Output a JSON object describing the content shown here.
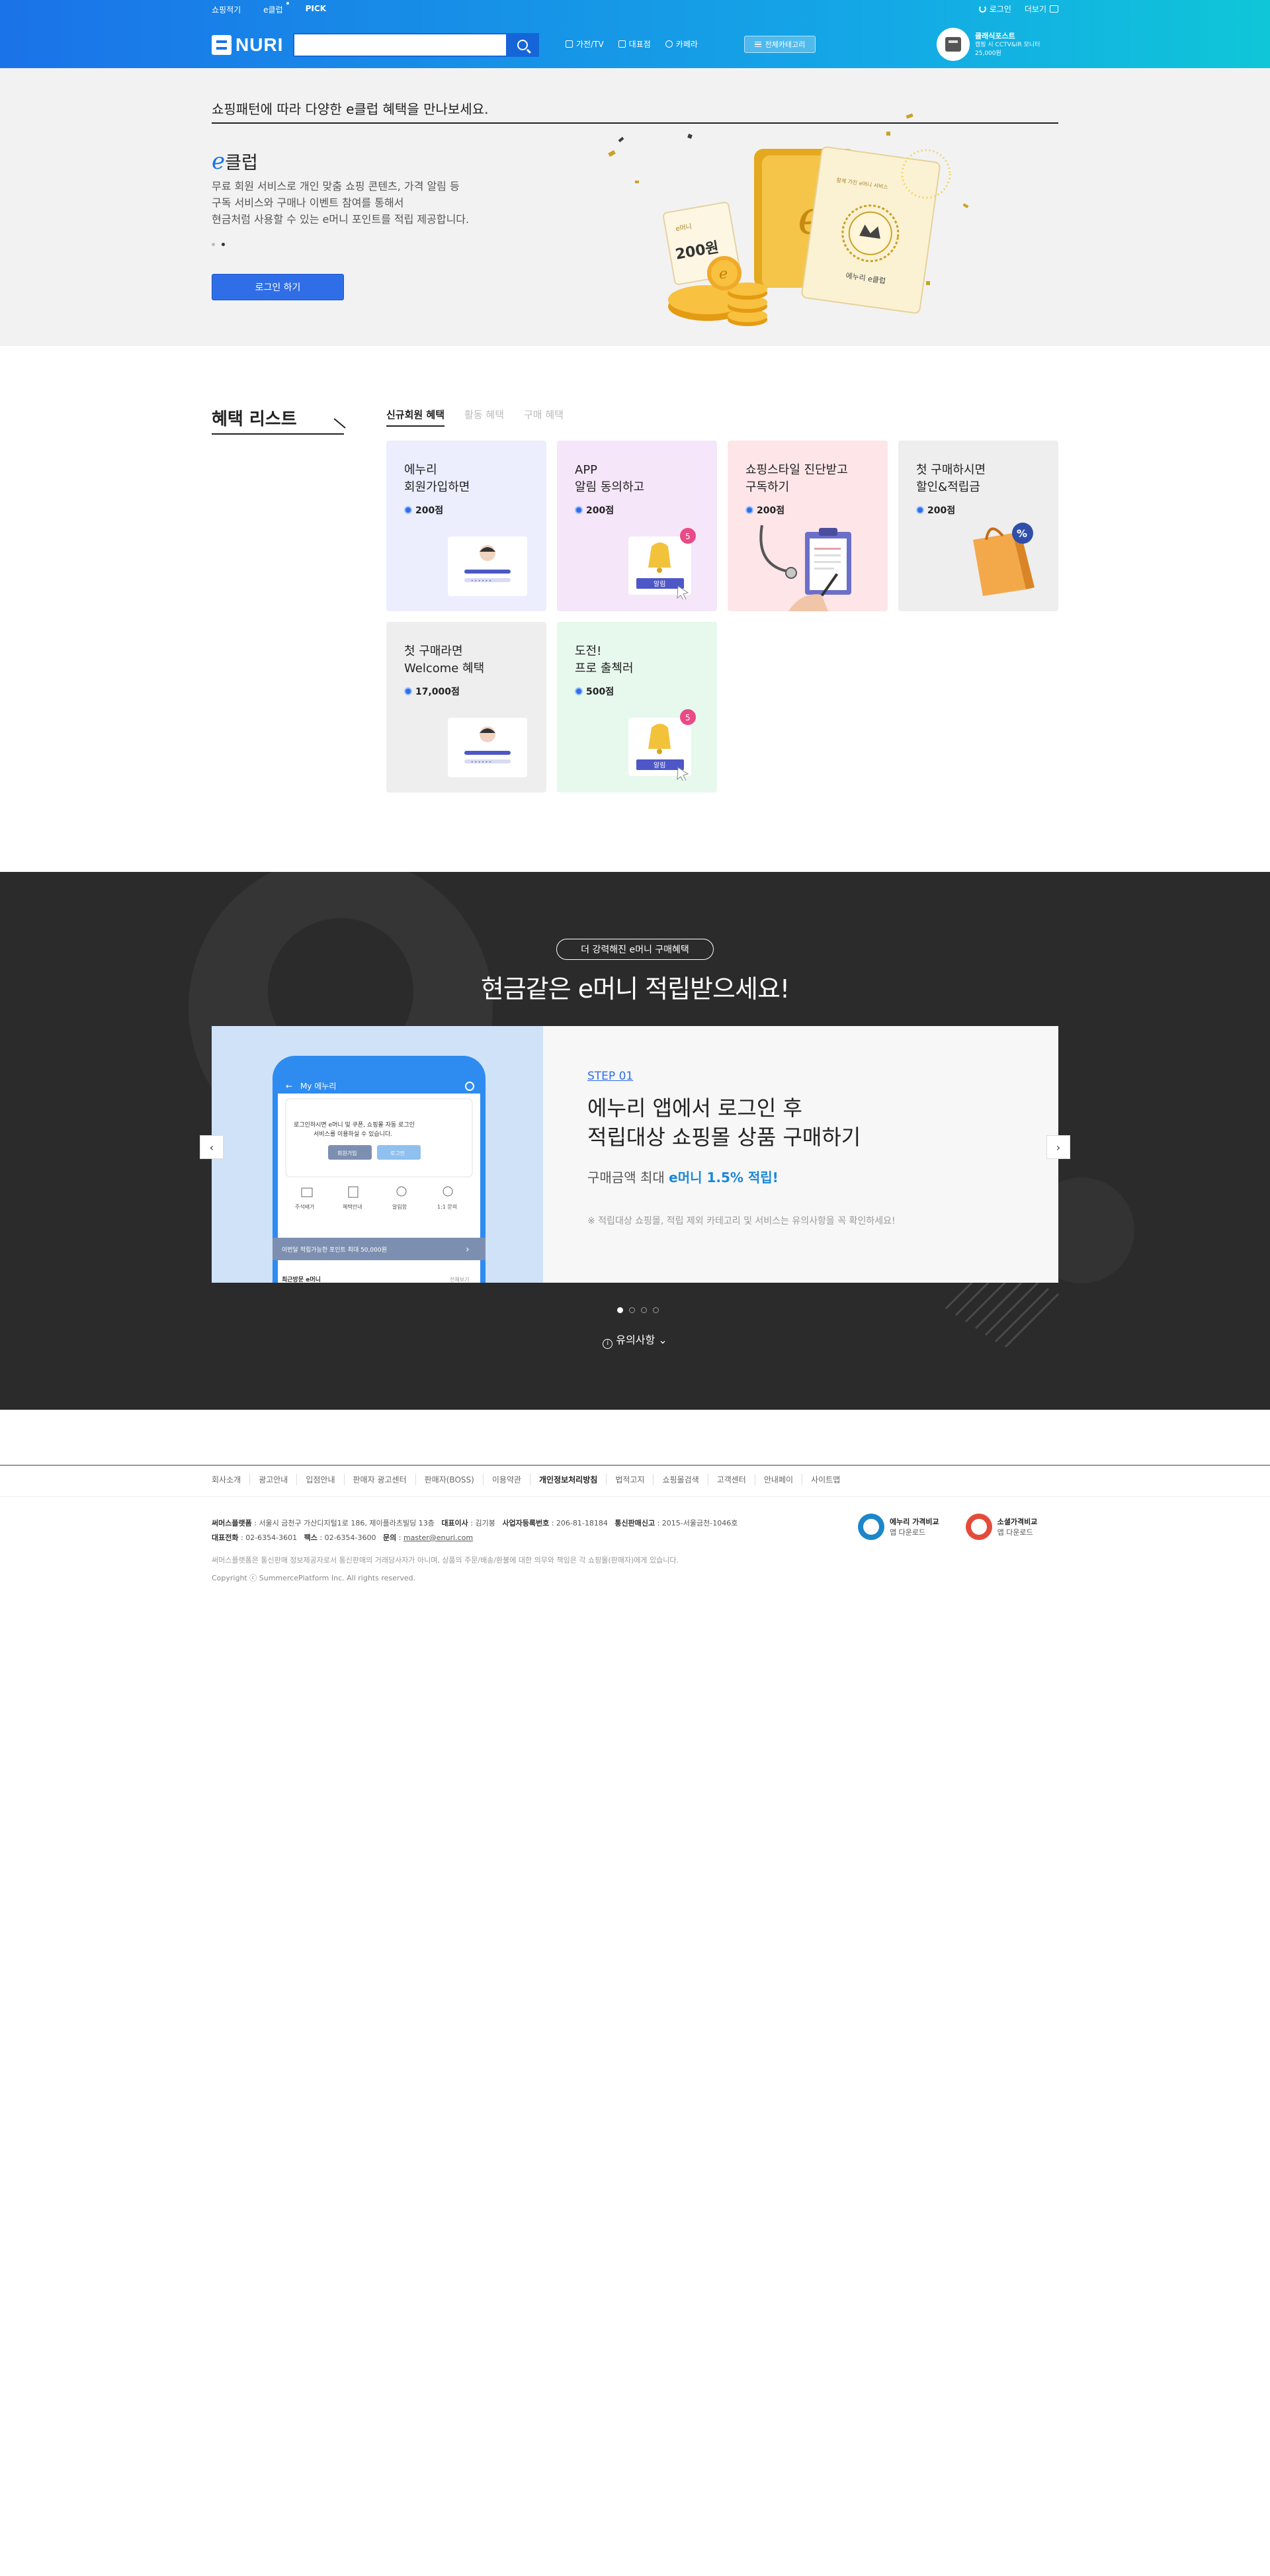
{
  "header": {
    "utility_left": [
      "쇼핑적기",
      "e클럽",
      "PICK"
    ],
    "utility_right": {
      "login": "로그인",
      "more": "더보기"
    },
    "logo_text": "NURI",
    "search_placeholder": "",
    "categories": [
      "가전/TV",
      "대표점",
      "카페라"
    ],
    "mall_button": "전체카테고리",
    "promo": {
      "title": "클래식포스트",
      "line1": "캠핑 시 CCTV&IR 모니터",
      "line2": "25,000원"
    }
  },
  "hero": {
    "heading": "쇼핑패턴에 따라 다양한 e클럽 혜택을 만나보세요.",
    "title_e": "e",
    "title_rest": "클럽",
    "desc": [
      "무료 회원 서비스로 개인 맞춤 쇼핑 콘텐츠, 가격 알림 등",
      "구독 서비스와 구매나 이벤트 참여를 통해서",
      "현금처럼 사용할 수 있는 e머니 포인트를 적립 제공합니다."
    ],
    "login_button": "로그인 하기",
    "illustration_text": {
      "card_top": "함께 가진 e머니 서비스",
      "card_bottom": "에누리 e클럽",
      "ticket_small": "e머니",
      "ticket_value": "200원"
    }
  },
  "benefits": {
    "title": "혜택 리스트",
    "tabs": [
      "신규회원 혜택",
      "활동 혜택",
      "구매 혜택"
    ],
    "cards": [
      {
        "title": "에누리\n회원가입하면",
        "points": "200점"
      },
      {
        "title": "APP\n알림 동의하고",
        "points": "200점",
        "badge": "5",
        "label": "알림"
      },
      {
        "title": "쇼핑스타일 진단받고\n구독하기",
        "points": "200점"
      },
      {
        "title": "첫 구매하시면\n할인&적립금",
        "points": "200점"
      },
      {
        "title": "첫 구매라면\nWelcome 혜택",
        "points": "17,000점"
      },
      {
        "title": "도전!\n프로 출첵러",
        "points": "500점",
        "badge": "5",
        "label": "알림"
      }
    ]
  },
  "promo_section": {
    "badge": "더 강력해진 e머니 구매혜택",
    "title": "현금같은 e머니 적립받으세요!",
    "phone": {
      "title": "My 에누리",
      "msg1": "로그인하시면 e머니 및 쿠폰, 쇼핑몰 자동 로그인",
      "msg2": "서비스를 이용하실 수 있습니다.",
      "btn1": "회원가입",
      "btn2": "로그인",
      "menu": [
        "주석배가",
        "혜택안내",
        "알림함",
        "1:1 문의"
      ],
      "bar": "이번달 적립가능한 포인트 최대 50,000원",
      "footer_left": "최근방문 e머니",
      "footer_right": "전체보기"
    },
    "step": "STEP 01",
    "heading": [
      "에누리 앱에서 로그인 후",
      "적립대상 쇼핑몰 상품 구매하기"
    ],
    "sub_prefix": "구매금액 최대 ",
    "sub_strong": "e머니 1.5% 적립!",
    "note": "※ 적립대상 쇼핑몰, 적립 제외 카테고리 및 서비스는 유의사항을 꼭 확인하세요!",
    "prev": "‹",
    "next": "›",
    "notice": "유의사항",
    "slide_count": 4,
    "active_slide": 1
  },
  "footer": {
    "links": [
      "회사소개",
      "광고안내",
      "입점안내",
      "판매자 광고센터",
      "판매자(BOSS)",
      "이용약관",
      "개인정보처리방침",
      "법적고지",
      "쇼핑몰검색",
      "고객센터",
      "안내페이",
      "사이트맵"
    ],
    "strong_link": "개인정보처리방침",
    "company": "써머스플랫폼",
    "address": "서울시 금천구 가산디지털1로 186, 제이플라츠빌딩 13층",
    "ceo_label": "대표이사",
    "ceo": "김기봉",
    "biz_label": "사업자등록번호",
    "biz": "206-81-18184",
    "sale_label": "통신판매신고",
    "sale": "2015-서울금천-1046호",
    "tel_label": "대표전화",
    "tel": "02-6354-3601",
    "fax_label": "팩스",
    "fax": "02-6354-3600",
    "mail_label": "문의",
    "mail": "master@enuri.com",
    "notice": "써머스플랫폼은 통신판매 정보제공자로서 통신판매의 거래당사자가 아니며, 상품의 주문/배송/환불에 대한 의무와 책임은 각 쇼핑몰(판매자)에게 있습니다.",
    "copyright": "Copyright ⓒ SummercePlatform Inc. All rights reserved.",
    "apps": [
      {
        "title": "에누리 가격비교",
        "sub": "앱 다운로드"
      },
      {
        "title": "소셜가격비교",
        "sub": "앱 다운로드"
      }
    ]
  },
  "colors": {
    "brand_blue": "#1a73e8",
    "accent_teal": "#0fc6d8",
    "point_blue": "#2f6ee6",
    "dark_bg": "#2b2b2b"
  }
}
